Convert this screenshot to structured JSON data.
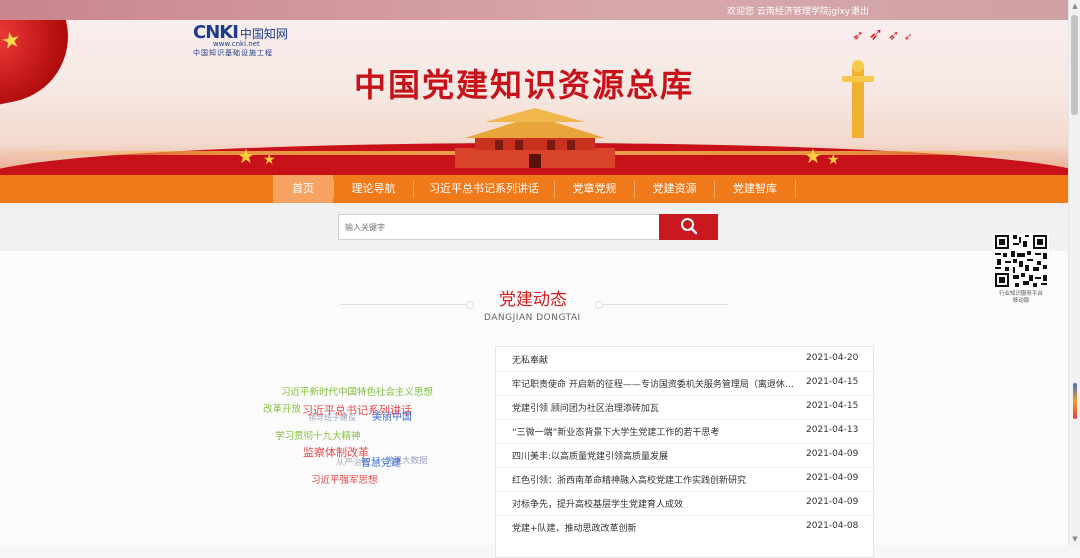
{
  "topbar": {
    "welcome": "欢迎您 云南经济管理学院jglxy ！",
    "logout": "退出"
  },
  "banner": {
    "logo_text": "CNKI",
    "logo_cn": "中国知网",
    "logo_url": "www.cnki.net",
    "logo_sub": "中国知识基础设施工程",
    "title": "中国党建知识资源总库"
  },
  "nav": {
    "items": [
      "首页",
      "理论导航",
      "习近平总书记系列讲话",
      "党章党规",
      "党建资源",
      "党建智库"
    ],
    "active_index": 0
  },
  "search": {
    "placeholder": "输入关键字",
    "button_icon": "search-icon"
  },
  "section": {
    "title": "党建动态",
    "subtitle": "DANGJIAN DONGTAI"
  },
  "tag_cloud": [
    {
      "text": "习近平新时代中国特色社会主义思想",
      "color": "#7fbf3a"
    },
    {
      "text": "改革开放",
      "color": "#86c23c"
    },
    {
      "text": "习近平总书记系列讲话",
      "color": "#e94a4a"
    },
    {
      "text": "美丽中国",
      "color": "#3a6fd8"
    },
    {
      "text": "领导班子建设",
      "color": "#9aa4c4"
    },
    {
      "text": "学习贯彻十九大精神",
      "color": "#86c23c"
    },
    {
      "text": "监察体制改革",
      "color": "#e94a4a"
    },
    {
      "text": "从严治党",
      "color": "#aab0c0"
    },
    {
      "text": "智慧党建",
      "color": "#3a6fd8"
    },
    {
      "text": "党建大数据",
      "color": "#9aa4c4"
    },
    {
      "text": "习近平强军思想",
      "color": "#e94a4a"
    }
  ],
  "news": [
    {
      "title": "无私奉献",
      "date": "2021-04-20"
    },
    {
      "title": "牢记职责使命 开启新的征程——专访国资委机关服务管理局（离退休干部局）",
      "date": "2021-04-15"
    },
    {
      "title": "党建引领 顾问团为社区治理添砖加瓦",
      "date": "2021-04-15"
    },
    {
      "title": "“三微一端”新业态背景下大学生党建工作的若干思考",
      "date": "2021-04-13"
    },
    {
      "title": "四川美丰:以高质量党建引领高质量发展",
      "date": "2021-04-09"
    },
    {
      "title": "红色引领：浙西南革命精神融入高校党建工作实践创新研究",
      "date": "2021-04-09"
    },
    {
      "title": "对标争先，提升高校基层学生党建育人成效",
      "date": "2021-04-09"
    },
    {
      "title": "党建+队建，推动思政改革创新",
      "date": "2021-04-08"
    }
  ],
  "qr": {
    "caption_line1": "行业知识服务平台",
    "caption_line2": "移动版"
  },
  "colors": {
    "nav_bg": "#f07a1a",
    "accent_red": "#c9181f",
    "title_red": "#d32020"
  }
}
